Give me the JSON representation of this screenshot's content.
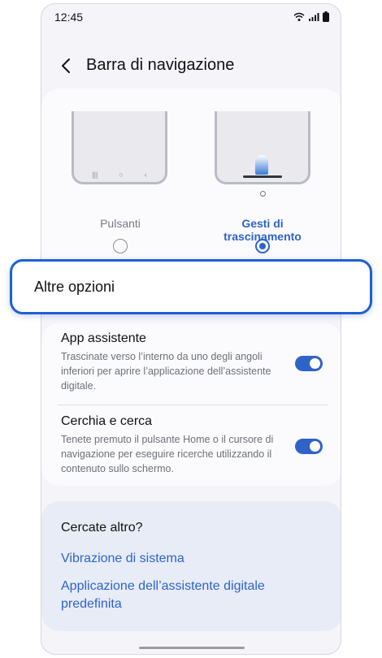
{
  "status_bar": {
    "time": "12:45"
  },
  "header": {
    "title": "Barra di navigazione"
  },
  "nav_type": {
    "options": [
      {
        "label": "Pulsanti",
        "selected": false
      },
      {
        "label": "Gesti di trascinamento",
        "selected": true
      }
    ]
  },
  "highlight": {
    "label": "Altre opzioni"
  },
  "settings": [
    {
      "title": "App assistente",
      "description": "Trascinate verso l’interno da uno degli angoli inferiori per aprire l’applicazione dell’assistente digitale.",
      "enabled": true
    },
    {
      "title": "Cerchia e cerca",
      "description": "Tenete premuto il pulsante Home o il cursore di navigazione per eseguire ricerche utilizzando il contenuto sullo schermo.",
      "enabled": true
    }
  ],
  "search_more": {
    "title": "Cercate altro?",
    "links": [
      "Vibrazione di sistema",
      "Applicazione dell’assistente digitale predefinita"
    ]
  },
  "colors": {
    "accent": "#2f63c8",
    "highlight_border": "#1f5fd1",
    "search_bg": "#e7ecf7"
  },
  "icons": [
    "wifi-icon",
    "signal-icon",
    "battery-icon",
    "back-arrow-icon"
  ]
}
